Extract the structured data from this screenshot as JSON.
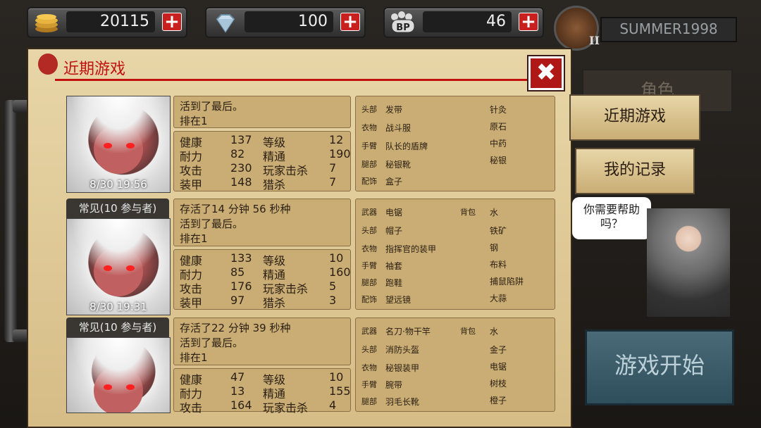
{
  "resources": [
    {
      "name": "gold",
      "value": "20115",
      "icon": "coin-stack-icon"
    },
    {
      "name": "diamond",
      "value": "100",
      "icon": "diamond-icon"
    },
    {
      "name": "bp",
      "value": "46",
      "icon": "bp-paw-icon",
      "icon_text": "BP"
    }
  ],
  "plus_label": "+",
  "user": {
    "name": "SUMMER1998",
    "rank": "II"
  },
  "panel": {
    "title": "近期游戏",
    "close": "✖"
  },
  "entries": [
    {
      "tag": "",
      "date": "8/30 19:56",
      "message": "活到了最后。\n排在1",
      "stats": [
        {
          "l1": "健康",
          "v1": "137",
          "l2": "等级",
          "v2": "12"
        },
        {
          "l1": "耐力",
          "v1": "82",
          "l2": "精通",
          "v2": "190"
        },
        {
          "l1": "攻击",
          "v1": "230",
          "l2": "玩家击杀",
          "v2": "7"
        },
        {
          "l1": "装甲",
          "v1": "148",
          "l2": "猎杀",
          "v2": "7"
        }
      ],
      "equip": [
        {
          "slot": "头部",
          "item": "发带",
          "extra": "针灸"
        },
        {
          "slot": "衣物",
          "item": "战斗服",
          "extra": "原石"
        },
        {
          "slot": "手臂",
          "item": "队长的盾牌",
          "extra": "中药"
        },
        {
          "slot": "腿部",
          "item": "秘银靴",
          "extra": "秘银"
        },
        {
          "slot": "配饰",
          "item": "盒子",
          "extra": ""
        }
      ]
    },
    {
      "tag": "常见(10 参与者)",
      "date": "8/30 19:31",
      "message": "存活了14 分钟 56 秒种\n活到了最后。\n排在1",
      "stats": [
        {
          "l1": "健康",
          "v1": "133",
          "l2": "等级",
          "v2": "10"
        },
        {
          "l1": "耐力",
          "v1": "85",
          "l2": "精通",
          "v2": "160"
        },
        {
          "l1": "攻击",
          "v1": "176",
          "l2": "玩家击杀",
          "v2": "5"
        },
        {
          "l1": "装甲",
          "v1": "97",
          "l2": "猎杀",
          "v2": "3"
        }
      ],
      "equip": [
        {
          "slot": "武器",
          "item": "电锯",
          "bag": "背包",
          "extra": "水"
        },
        {
          "slot": "头部",
          "item": "帽子",
          "extra": "铁矿"
        },
        {
          "slot": "衣物",
          "item": "指挥官的装甲",
          "extra": "钢"
        },
        {
          "slot": "手臂",
          "item": "袖套",
          "extra": "布料"
        },
        {
          "slot": "腿部",
          "item": "跑鞋",
          "extra": "捕鼠陷阱"
        },
        {
          "slot": "配饰",
          "item": "望远镜",
          "extra": "大蒜"
        }
      ]
    },
    {
      "tag": "常见(10 参与者)",
      "date": "",
      "message": "存活了22 分钟 39 秒种\n活到了最后。\n排在1",
      "stats": [
        {
          "l1": "健康",
          "v1": "47",
          "l2": "等级",
          "v2": "10"
        },
        {
          "l1": "耐力",
          "v1": "13",
          "l2": "精通",
          "v2": "155"
        },
        {
          "l1": "攻击",
          "v1": "164",
          "l2": "玩家击杀",
          "v2": "4"
        }
      ],
      "equip": [
        {
          "slot": "武器",
          "item": "名刀·物干竿",
          "bag": "背包",
          "extra": "水"
        },
        {
          "slot": "头部",
          "item": "消防头盔",
          "extra": "金子"
        },
        {
          "slot": "衣物",
          "item": "秘银装甲",
          "extra": "电锯"
        },
        {
          "slot": "手臂",
          "item": "腕带",
          "extra": "树枝"
        },
        {
          "slot": "腿部",
          "item": "羽毛长靴",
          "extra": "橙子"
        }
      ]
    }
  ],
  "side": {
    "tab_character": "角色",
    "tab_recent": "近期游戏",
    "tab_records": "我的记录",
    "help": "你需要帮助\n吗？",
    "start": "游戏开始"
  }
}
